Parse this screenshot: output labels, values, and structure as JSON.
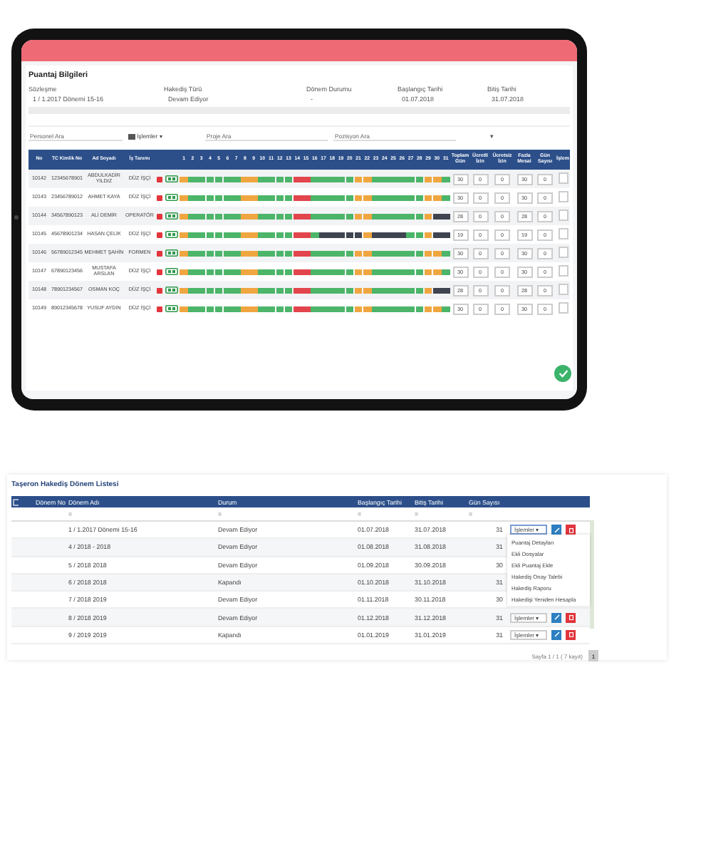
{
  "tablet": {
    "title": "Puantaj Bilgileri",
    "form": [
      {
        "label": "Sözleşme",
        "value": "1 / 1.2017 Dönemi 15-16"
      },
      {
        "label": "Hakediş Türü",
        "value": "Devam Ediyor"
      },
      {
        "label": "Dönem Durumu",
        "value": "-"
      },
      {
        "label": "Başlangıç Tarihi",
        "value": "01.07.2018"
      },
      {
        "label": "Bitiş Tarihi",
        "value": "31.07.2018"
      }
    ],
    "filters": {
      "search_placeholder": "Personel Ara",
      "menu": "İşlemler ▾",
      "project_placeholder": "Proje Ara",
      "position_placeholder": "Pozisyon Ara",
      "select": "▾"
    },
    "columns": [
      "No",
      "TC Kimlik No",
      "Ad Soyadı",
      "İş Tanımı"
    ],
    "total_columns": [
      "Toplam Gün",
      "Ücretli İzin",
      "Ücretsiz İzin",
      "Fazla Mesai",
      "Gün Sayısı",
      "İşlem"
    ],
    "day_labels": [
      "1",
      "2",
      "3",
      "4",
      "5",
      "6",
      "7",
      "8",
      "9",
      "10",
      "11",
      "12",
      "13",
      "14",
      "15",
      "16",
      "17",
      "18",
      "19",
      "20",
      "21",
      "22",
      "23",
      "24",
      "25",
      "26",
      "27",
      "28",
      "29",
      "30",
      "31"
    ],
    "rows": [
      {
        "no": "10142",
        "tc": "12345678901",
        "name": "ABDULKADİR YILDIZ",
        "job": "DÜZ İŞÇİ",
        "totals": [
          "30",
          "0",
          "0",
          "30",
          "0"
        ],
        "days": [
          {
            "kind": "off"
          },
          {
            "kind": "work"
          },
          {
            "kind": "work"
          },
          {
            "kind": "work"
          },
          {
            "kind": "work"
          },
          {
            "kind": "work"
          },
          {
            "kind": "work"
          },
          {
            "kind": "off"
          },
          {
            "kind": "off"
          },
          {
            "kind": "work"
          },
          {
            "kind": "work"
          },
          {
            "kind": "work"
          },
          {
            "kind": "work"
          },
          {
            "kind": "holiday"
          },
          {
            "kind": "holiday"
          },
          {
            "kind": "work"
          },
          {
            "kind": "work"
          },
          {
            "kind": "work"
          },
          {
            "kind": "work"
          },
          {
            "kind": "work"
          },
          {
            "kind": "off"
          },
          {
            "kind": "off"
          },
          {
            "kind": "work"
          },
          {
            "kind": "work"
          },
          {
            "kind": "work"
          },
          {
            "kind": "work"
          },
          {
            "kind": "work"
          },
          {
            "kind": "work"
          },
          {
            "kind": "off"
          },
          {
            "kind": "off"
          },
          {
            "kind": "work"
          }
        ]
      },
      {
        "no": "10143",
        "tc": "23456789012",
        "name": "AHMET KAYA",
        "job": "DÜZ İŞÇİ",
        "totals": [
          "30",
          "0",
          "0",
          "30",
          "0"
        ],
        "days": [
          {
            "kind": "off"
          },
          {
            "kind": "work"
          },
          {
            "kind": "work"
          },
          {
            "kind": "work"
          },
          {
            "kind": "work"
          },
          {
            "kind": "work"
          },
          {
            "kind": "work"
          },
          {
            "kind": "off"
          },
          {
            "kind": "off"
          },
          {
            "kind": "work"
          },
          {
            "kind": "work"
          },
          {
            "kind": "work"
          },
          {
            "kind": "work"
          },
          {
            "kind": "holiday"
          },
          {
            "kind": "holiday"
          },
          {
            "kind": "work"
          },
          {
            "kind": "work"
          },
          {
            "kind": "work"
          },
          {
            "kind": "work"
          },
          {
            "kind": "work"
          },
          {
            "kind": "off"
          },
          {
            "kind": "off"
          },
          {
            "kind": "work"
          },
          {
            "kind": "work"
          },
          {
            "kind": "work"
          },
          {
            "kind": "work"
          },
          {
            "kind": "work"
          },
          {
            "kind": "work"
          },
          {
            "kind": "off"
          },
          {
            "kind": "off"
          },
          {
            "kind": "work"
          }
        ]
      },
      {
        "no": "10144",
        "tc": "34567890123",
        "name": "ALİ DEMİR",
        "job": "OPERATÖR",
        "totals": [
          "28",
          "0",
          "0",
          "28",
          "0"
        ],
        "days": [
          {
            "kind": "off"
          },
          {
            "kind": "work"
          },
          {
            "kind": "work"
          },
          {
            "kind": "work"
          },
          {
            "kind": "work"
          },
          {
            "kind": "work"
          },
          {
            "kind": "work"
          },
          {
            "kind": "off"
          },
          {
            "kind": "off"
          },
          {
            "kind": "work"
          },
          {
            "kind": "work"
          },
          {
            "kind": "work"
          },
          {
            "kind": "work"
          },
          {
            "kind": "holiday"
          },
          {
            "kind": "holiday"
          },
          {
            "kind": "work"
          },
          {
            "kind": "work"
          },
          {
            "kind": "work"
          },
          {
            "kind": "work"
          },
          {
            "kind": "work"
          },
          {
            "kind": "off"
          },
          {
            "kind": "off"
          },
          {
            "kind": "work"
          },
          {
            "kind": "work"
          },
          {
            "kind": "work"
          },
          {
            "kind": "work"
          },
          {
            "kind": "work"
          },
          {
            "kind": "work"
          },
          {
            "kind": "off"
          },
          {
            "kind": "absent"
          },
          {
            "kind": "absent"
          }
        ]
      },
      {
        "no": "10145",
        "tc": "45678901234",
        "name": "HASAN ÇELİK",
        "job": "DÜZ İŞÇİ",
        "totals": [
          "19",
          "0",
          "0",
          "19",
          "0"
        ],
        "days": [
          {
            "kind": "off"
          },
          {
            "kind": "work"
          },
          {
            "kind": "work"
          },
          {
            "kind": "work"
          },
          {
            "kind": "work"
          },
          {
            "kind": "work"
          },
          {
            "kind": "work"
          },
          {
            "kind": "off"
          },
          {
            "kind": "off"
          },
          {
            "kind": "work"
          },
          {
            "kind": "work"
          },
          {
            "kind": "work"
          },
          {
            "kind": "work"
          },
          {
            "kind": "holiday"
          },
          {
            "kind": "holiday"
          },
          {
            "kind": "work"
          },
          {
            "kind": "absent"
          },
          {
            "kind": "absent"
          },
          {
            "kind": "absent"
          },
          {
            "kind": "absent"
          },
          {
            "kind": "absent"
          },
          {
            "kind": "off"
          },
          {
            "kind": "absent"
          },
          {
            "kind": "absent"
          },
          {
            "kind": "absent"
          },
          {
            "kind": "absent"
          },
          {
            "kind": "work"
          },
          {
            "kind": "work"
          },
          {
            "kind": "off"
          },
          {
            "kind": "absent"
          },
          {
            "kind": "absent"
          }
        ]
      },
      {
        "no": "10146",
        "tc": "56789012345",
        "name": "MEHMET ŞAHİN",
        "job": "FORMEN",
        "totals": [
          "30",
          "0",
          "0",
          "30",
          "0"
        ],
        "days": [
          {
            "kind": "off"
          },
          {
            "kind": "work"
          },
          {
            "kind": "work"
          },
          {
            "kind": "work"
          },
          {
            "kind": "work"
          },
          {
            "kind": "work"
          },
          {
            "kind": "work"
          },
          {
            "kind": "off"
          },
          {
            "kind": "off"
          },
          {
            "kind": "work"
          },
          {
            "kind": "work"
          },
          {
            "kind": "work"
          },
          {
            "kind": "work"
          },
          {
            "kind": "holiday"
          },
          {
            "kind": "holiday"
          },
          {
            "kind": "work"
          },
          {
            "kind": "work"
          },
          {
            "kind": "work"
          },
          {
            "kind": "work"
          },
          {
            "kind": "work"
          },
          {
            "kind": "off"
          },
          {
            "kind": "off"
          },
          {
            "kind": "work"
          },
          {
            "kind": "work"
          },
          {
            "kind": "work"
          },
          {
            "kind": "work"
          },
          {
            "kind": "work"
          },
          {
            "kind": "work"
          },
          {
            "kind": "off"
          },
          {
            "kind": "off"
          },
          {
            "kind": "work"
          }
        ]
      },
      {
        "no": "10147",
        "tc": "67890123456",
        "name": "MUSTAFA ARSLAN",
        "job": "DÜZ İŞÇİ",
        "totals": [
          "30",
          "0",
          "0",
          "30",
          "0"
        ],
        "days": [
          {
            "kind": "off"
          },
          {
            "kind": "work"
          },
          {
            "kind": "work"
          },
          {
            "kind": "work"
          },
          {
            "kind": "work"
          },
          {
            "kind": "work"
          },
          {
            "kind": "work"
          },
          {
            "kind": "off"
          },
          {
            "kind": "off"
          },
          {
            "kind": "work"
          },
          {
            "kind": "work"
          },
          {
            "kind": "work"
          },
          {
            "kind": "work"
          },
          {
            "kind": "holiday"
          },
          {
            "kind": "holiday"
          },
          {
            "kind": "work"
          },
          {
            "kind": "work"
          },
          {
            "kind": "work"
          },
          {
            "kind": "work"
          },
          {
            "kind": "work"
          },
          {
            "kind": "off"
          },
          {
            "kind": "off"
          },
          {
            "kind": "work"
          },
          {
            "kind": "work"
          },
          {
            "kind": "work"
          },
          {
            "kind": "work"
          },
          {
            "kind": "work"
          },
          {
            "kind": "work"
          },
          {
            "kind": "off"
          },
          {
            "kind": "off"
          },
          {
            "kind": "work"
          }
        ]
      },
      {
        "no": "10148",
        "tc": "78901234567",
        "name": "OSMAN KOÇ",
        "job": "DÜZ İŞÇİ",
        "totals": [
          "28",
          "0",
          "0",
          "28",
          "0"
        ],
        "days": [
          {
            "kind": "off"
          },
          {
            "kind": "work"
          },
          {
            "kind": "work"
          },
          {
            "kind": "work"
          },
          {
            "kind": "work"
          },
          {
            "kind": "work"
          },
          {
            "kind": "work"
          },
          {
            "kind": "off"
          },
          {
            "kind": "off"
          },
          {
            "kind": "work"
          },
          {
            "kind": "work"
          },
          {
            "kind": "work"
          },
          {
            "kind": "work"
          },
          {
            "kind": "holiday"
          },
          {
            "kind": "holiday"
          },
          {
            "kind": "work"
          },
          {
            "kind": "work"
          },
          {
            "kind": "work"
          },
          {
            "kind": "work"
          },
          {
            "kind": "work"
          },
          {
            "kind": "off"
          },
          {
            "kind": "off"
          },
          {
            "kind": "work"
          },
          {
            "kind": "work"
          },
          {
            "kind": "work"
          },
          {
            "kind": "work"
          },
          {
            "kind": "work"
          },
          {
            "kind": "work"
          },
          {
            "kind": "off"
          },
          {
            "kind": "absent"
          },
          {
            "kind": "absent"
          }
        ]
      },
      {
        "no": "10149",
        "tc": "89012345678",
        "name": "YUSUF AYDIN",
        "job": "DÜZ İŞÇİ",
        "totals": [
          "30",
          "0",
          "0",
          "30",
          "0"
        ],
        "days": [
          {
            "kind": "off"
          },
          {
            "kind": "work"
          },
          {
            "kind": "work"
          },
          {
            "kind": "work"
          },
          {
            "kind": "work"
          },
          {
            "kind": "work"
          },
          {
            "kind": "work"
          },
          {
            "kind": "off"
          },
          {
            "kind": "off"
          },
          {
            "kind": "work"
          },
          {
            "kind": "work"
          },
          {
            "kind": "work"
          },
          {
            "kind": "work"
          },
          {
            "kind": "holiday"
          },
          {
            "kind": "holiday"
          },
          {
            "kind": "work"
          },
          {
            "kind": "work"
          },
          {
            "kind": "work"
          },
          {
            "kind": "work"
          },
          {
            "kind": "work"
          },
          {
            "kind": "off"
          },
          {
            "kind": "off"
          },
          {
            "kind": "work"
          },
          {
            "kind": "work"
          },
          {
            "kind": "work"
          },
          {
            "kind": "work"
          },
          {
            "kind": "work"
          },
          {
            "kind": "work"
          },
          {
            "kind": "off"
          },
          {
            "kind": "off"
          },
          {
            "kind": "work"
          }
        ]
      }
    ]
  },
  "list": {
    "title": "Taşeron Hakediş Dönem Listesi",
    "select_all": {
      "checked": false
    },
    "columns": [
      "Dönem No",
      "Dönem Adı",
      "Durum",
      "Başlangıç Tarihi",
      "Bitiş Tarihi",
      "Gün Sayısı"
    ],
    "filter_ops": [
      "=",
      "=",
      "=",
      "=",
      "="
    ],
    "rows": [
      {
        "name": "1 / 1.2017 Dönemi 15-16",
        "status": "Devam Ediyor",
        "start": "01.07.2018",
        "end": "31.07.2018",
        "days": "31",
        "menu": "İşlemler ▾",
        "expanded": true
      },
      {
        "name": "4 / 2018 - 2018",
        "status": "Devam Ediyor",
        "start": "01.08.2018",
        "end": "31.08.2018",
        "days": "31",
        "expanded": false
      },
      {
        "name": "5 / 2018 2018",
        "status": "Devam Ediyor",
        "start": "01.09.2018",
        "end": "30.09.2018",
        "days": "30",
        "expanded": false
      },
      {
        "name": "6 / 2018 2018",
        "status": "Kapandı",
        "start": "01.10.2018",
        "end": "31.10.2018",
        "days": "31",
        "expanded": false
      },
      {
        "name": "7 / 2018 2019",
        "status": "Devam Ediyor",
        "start": "01.11.2018",
        "end": "30.11.2018",
        "days": "30",
        "expanded": false
      },
      {
        "name": "8 / 2018 2019",
        "status": "Devam Ediyor",
        "start": "01.12.2018",
        "end": "31.12.2018",
        "days": "31",
        "menu": "İşlemler ▾",
        "expanded": false
      },
      {
        "name": "9 / 2019 2019",
        "status": "Kapandı",
        "start": "01.01.2019",
        "end": "31.01.2019",
        "days": "31",
        "menu": "İşlemler ▾",
        "expanded": false
      }
    ],
    "menu_items": [
      "Puantaj Detayları",
      "Ekli Dosyalar",
      "Ekli Puantaj Ekle",
      "Hakediş Onay Talebi",
      "Hakediş Raporu",
      "Hakedişi Yeniden Hesapla"
    ],
    "pager_info": "Sayfa 1 / 1 ( 7 kayıt)",
    "page": "1"
  }
}
